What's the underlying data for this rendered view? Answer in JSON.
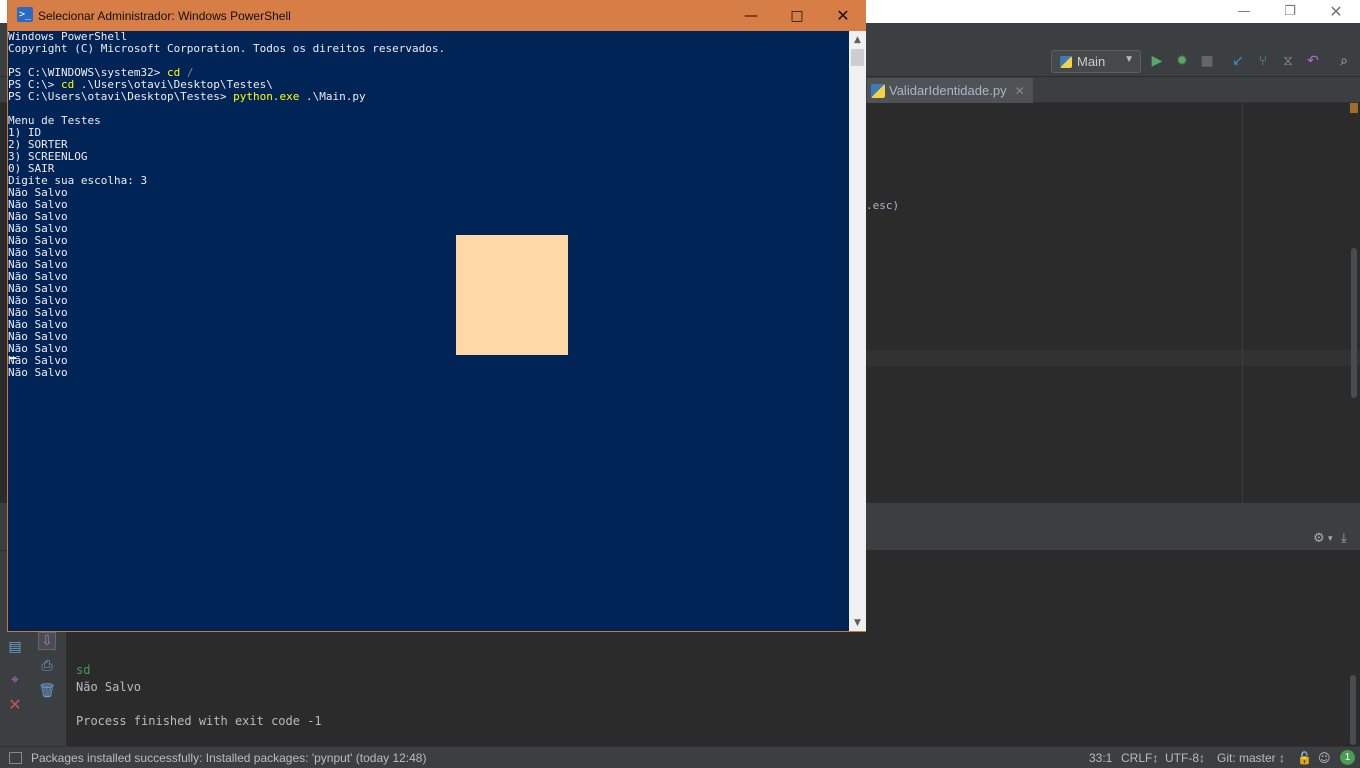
{
  "ide": {
    "run_config": "Main",
    "editor_tab": "ValidarIdentidade.py",
    "editor_code_fragment": ".esc)",
    "console": {
      "lines": [
        "sd",
        "Não Salvo",
        "",
        "Process finished with exit code -1"
      ]
    },
    "statusbar": {
      "message": "Packages installed successfully: Installed packages: 'pynput' (today 12:48)",
      "position": "33:1",
      "line_sep": "CRLF↕",
      "encoding": "UTF-8↕",
      "vcs": "Git: master ↕",
      "badge": "1"
    }
  },
  "powershell": {
    "title": "Selecionar Administrador: Windows PowerShell",
    "lines": [
      [
        {
          "t": "Windows PowerShell"
        }
      ],
      [
        {
          "t": "Copyright (C) Microsoft Corporation. Todos os direitos reservados."
        }
      ],
      [
        {
          "t": ""
        }
      ],
      [
        {
          "t": "PS C:\\WINDOWS\\system32> "
        },
        {
          "t": "cd",
          "c": "y"
        },
        {
          "t": " /",
          "c": "g"
        }
      ],
      [
        {
          "t": "PS C:\\> "
        },
        {
          "t": "cd",
          "c": "y"
        },
        {
          "t": " .\\Users\\otavi\\Desktop\\Testes\\"
        }
      ],
      [
        {
          "t": "PS C:\\Users\\otavi\\Desktop\\Testes> "
        },
        {
          "t": "python.exe",
          "c": "y"
        },
        {
          "t": " .\\Main.py"
        }
      ],
      [
        {
          "t": ""
        }
      ],
      [
        {
          "t": "Menu de Testes"
        }
      ],
      [
        {
          "t": "1) ID"
        }
      ],
      [
        {
          "t": "2) SORTER"
        }
      ],
      [
        {
          "t": "3) SCREENLOG"
        }
      ],
      [
        {
          "t": "0) SAIR"
        }
      ],
      [
        {
          "t": "Digite sua escolha: 3"
        }
      ],
      [
        {
          "t": "Não Salvo"
        }
      ],
      [
        {
          "t": "Não Salvo"
        }
      ],
      [
        {
          "t": "Não Salvo"
        }
      ],
      [
        {
          "t": "Não Salvo"
        }
      ],
      [
        {
          "t": "Não Salvo"
        }
      ],
      [
        {
          "t": "Não Salvo"
        }
      ],
      [
        {
          "t": "Não Salvo"
        }
      ],
      [
        {
          "t": "Não Salvo"
        }
      ],
      [
        {
          "t": "Não Salvo"
        }
      ],
      [
        {
          "t": "Não Salvo"
        }
      ],
      [
        {
          "t": "Não Salvo"
        }
      ],
      [
        {
          "t": "Não Salvo"
        }
      ],
      [
        {
          "t": "Não Salvo"
        }
      ],
      [
        {
          "t": "Não Salvo"
        }
      ],
      [
        {
          "t": "Não Salvo"
        }
      ],
      [
        {
          "t": "Não Salvo"
        }
      ]
    ]
  },
  "icons": [
    "powershell-icon",
    "minimize-icon",
    "maximize-icon",
    "close-icon",
    "run-icon",
    "debug-icon",
    "stop-icon",
    "vcs-update-icon",
    "vcs-commit-icon",
    "history-icon",
    "revert-icon",
    "search-icon",
    "python-file-icon",
    "settings-icon",
    "download-icon",
    "rerun-icon",
    "print-icon",
    "trash-icon",
    "pin-icon",
    "layout-icon",
    "lock-icon",
    "inspector-icon",
    "event-log-icon"
  ]
}
